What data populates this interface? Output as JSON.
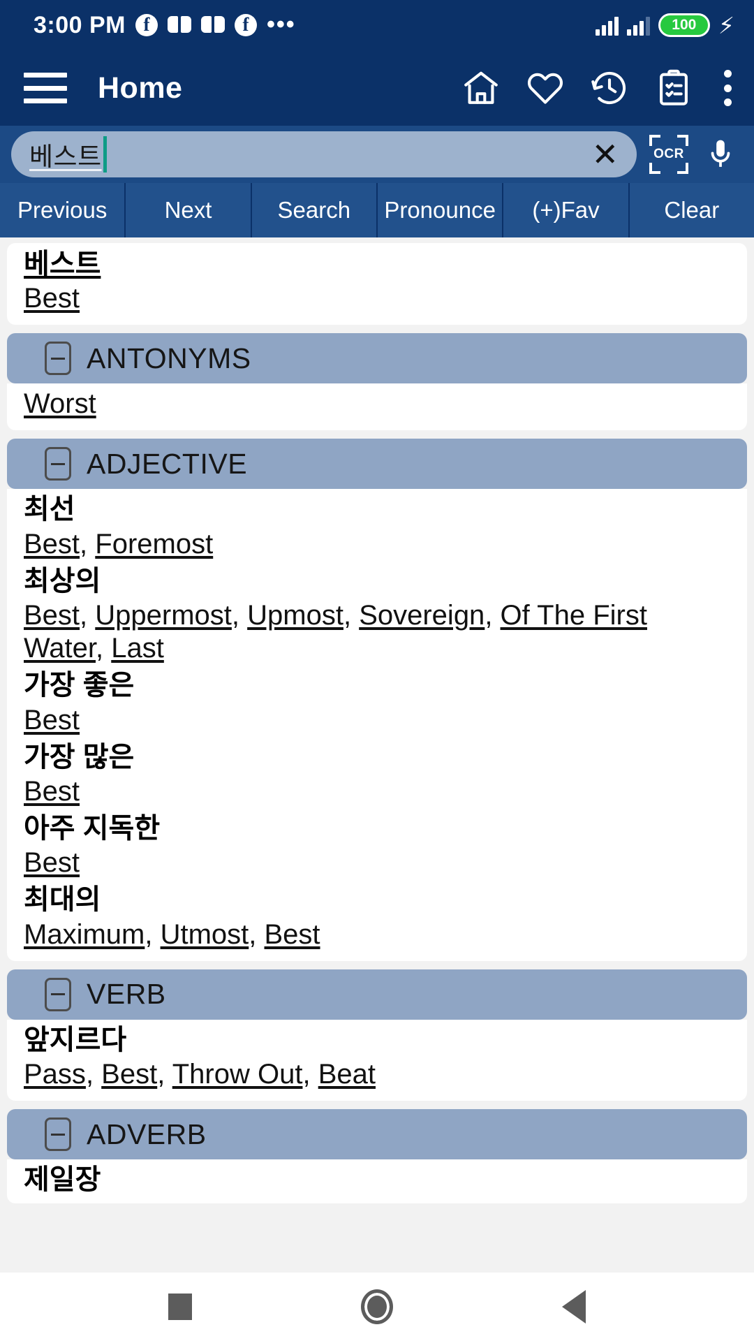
{
  "status_bar": {
    "time": "3:00 PM",
    "left_icons": [
      "facebook-icon",
      "book-icon",
      "book-icon",
      "facebook-icon",
      "more-dots-icon"
    ],
    "right_icons": [
      "signal-bars-icon",
      "signal-bars-icon",
      "battery-icon",
      "charging-bolt-icon"
    ],
    "battery_level": "100"
  },
  "app_bar": {
    "title": "Home",
    "menu_icon": "hamburger-icon",
    "actions": [
      "home-icon",
      "heart-icon",
      "history-icon",
      "clipboard-check-icon",
      "overflow-menu-icon"
    ]
  },
  "search": {
    "value": "베스트",
    "placeholder": "",
    "clear_label": "✕",
    "ocr_label": "OCR",
    "ocr_icon": "ocr-scan-icon",
    "mic_icon": "microphone-icon"
  },
  "action_buttons": [
    {
      "label": "Previous",
      "name": "previous-button"
    },
    {
      "label": "Next",
      "name": "next-button"
    },
    {
      "label": "Search",
      "name": "search-button"
    },
    {
      "label": "Pronounce",
      "name": "pronounce-button"
    },
    {
      "label": "(+)Fav",
      "name": "add-favorite-button"
    },
    {
      "label": "Clear",
      "name": "clear-button"
    }
  ],
  "result": {
    "headword_kr": "베스트",
    "headword_en": "Best"
  },
  "sections": [
    {
      "title": "ANTONYMS",
      "collapse_icon": "minus-box-icon",
      "entries": [
        {
          "kr": "",
          "en": [
            "Worst"
          ]
        }
      ]
    },
    {
      "title": "ADJECTIVE",
      "collapse_icon": "minus-box-icon",
      "entries": [
        {
          "kr": "최선",
          "en": [
            "Best",
            "Foremost"
          ]
        },
        {
          "kr": "최상의",
          "en": [
            "Best",
            "Uppermost",
            "Upmost",
            "Sovereign",
            "Of The First Water",
            "Last"
          ]
        },
        {
          "kr": "가장 좋은",
          "en": [
            "Best"
          ]
        },
        {
          "kr": "가장 많은",
          "en": [
            "Best"
          ]
        },
        {
          "kr": "아주 지독한",
          "en": [
            "Best"
          ]
        },
        {
          "kr": "최대의",
          "en": [
            "Maximum",
            "Utmost",
            "Best"
          ]
        }
      ]
    },
    {
      "title": "VERB",
      "collapse_icon": "minus-box-icon",
      "entries": [
        {
          "kr": "앞지르다",
          "en": [
            "Pass",
            "Best",
            "Throw Out",
            "Beat"
          ]
        }
      ]
    },
    {
      "title": "ADVERB",
      "collapse_icon": "minus-box-icon",
      "entries": [
        {
          "kr": "제일장",
          "en": []
        }
      ]
    }
  ],
  "nav_bar": {
    "recents": "square-recents-icon",
    "home": "circle-home-icon",
    "back": "triangle-back-icon"
  },
  "colors": {
    "app_bar_blue": "#0b3168",
    "search_blue": "#1c4a85",
    "button_blue": "#22518c",
    "section_header_blue": "#8fa5c4",
    "search_field": "#9db2cd",
    "battery_green": "#27c93f",
    "caret_teal": "#0e9c86"
  }
}
